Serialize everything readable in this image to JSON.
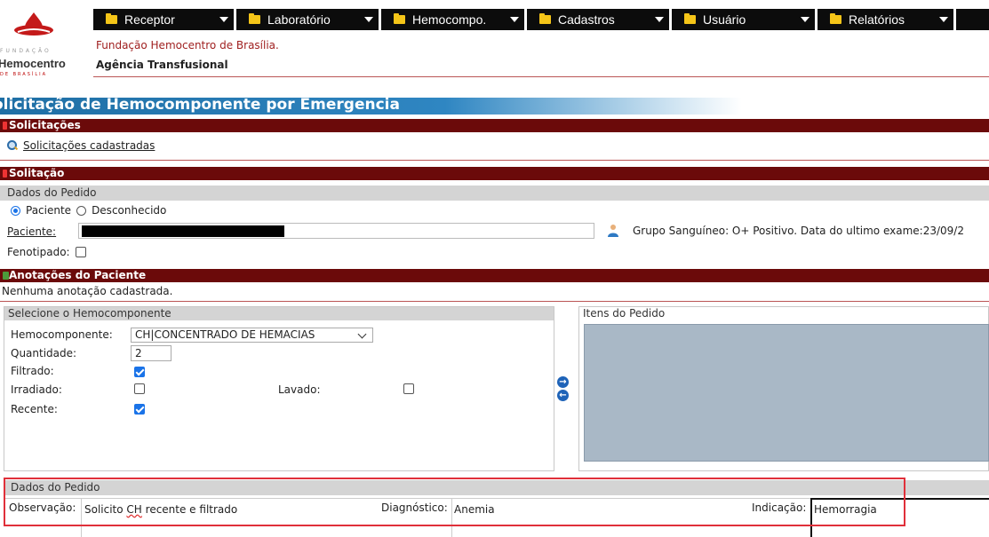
{
  "logo": {
    "small_text": "FUNDAÇÃO",
    "name": "Hemocentro",
    "sub_text": "DE BRASÍLIA"
  },
  "menu": [
    {
      "label": "Receptor"
    },
    {
      "label": "Laboratório"
    },
    {
      "label": "Hemocompo."
    },
    {
      "label": "Cadastros"
    },
    {
      "label": "Usuário"
    },
    {
      "label": "Relatórios"
    }
  ],
  "header": {
    "org": "Fundação Hemocentro de Brasília.",
    "agency": "Agência Transfusional"
  },
  "page_title": "olicitação de Hemocomponente por Emergencia",
  "sections": {
    "solicitacoes": "Solicitações",
    "solicitacoes_link": "Solicitações cadastradas",
    "solitacao": "Solitação",
    "dados_pedido": "Dados do Pedido",
    "anotacoes": "Anotações do Paciente",
    "anotacoes_empty": "Nenhuma anotação cadastrada."
  },
  "patient": {
    "radio_paciente": "Paciente",
    "radio_desconhecido": "Desconhecido",
    "label": "Paciente:",
    "blood_info": "Grupo Sanguíneo: O+ Positivo. Data do ultimo exame:23/09/2",
    "fenotipado_label": "Fenotipado:"
  },
  "hemocomponente_panel": {
    "title": "Selecione o Hemocomponente",
    "hemocomponente_label": "Hemocomponente:",
    "hemocomponente_value": "CH|CONCENTRADO DE HEMACIAS",
    "quantidade_label": "Quantidade:",
    "quantidade_value": "2",
    "filtrado_label": "Filtrado:",
    "irradiado_label": "Irradiado:",
    "lavado_label": "Lavado:",
    "recente_label": "Recente:",
    "filtrado": true,
    "irradiado": false,
    "lavado": false,
    "recente": true
  },
  "itens_panel": {
    "title": "Itens do Pedido"
  },
  "pedido_fields": {
    "header": "Dados do Pedido",
    "observacao_label": "Observação:",
    "observacao_value_pre": "Solicito ",
    "observacao_value_ch": "CH",
    "observacao_value_post": " recente e filtrado",
    "diagnostico_label": "Diagnóstico:",
    "diagnostico_value": "Anemia",
    "indicacao_label": "Indicação:",
    "indicacao_value": "Hemorragia"
  },
  "colors": {
    "section_bar": "#6b0a0a",
    "menu_bar": "#0c0c0c",
    "title_blue": "#2f86c2",
    "highlight_red": "#e0303a",
    "items_area": "#a9b8c6"
  }
}
